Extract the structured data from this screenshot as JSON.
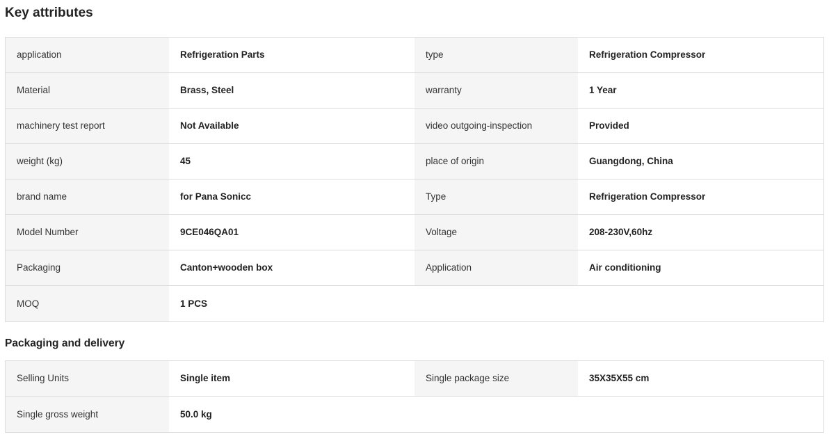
{
  "key_attributes": {
    "title": "Key attributes",
    "rows": [
      {
        "l1": "application",
        "v1": "Refrigeration Parts",
        "l2": "type",
        "v2": "Refrigeration Compressor"
      },
      {
        "l1": "Material",
        "v1": "Brass, Steel",
        "l2": "warranty",
        "v2": "1 Year"
      },
      {
        "l1": "machinery test report",
        "v1": "Not Available",
        "l2": "video outgoing-inspection",
        "v2": "Provided"
      },
      {
        "l1": "weight (kg)",
        "v1": "45",
        "l2": "place of origin",
        "v2": "Guangdong, China"
      },
      {
        "l1": "brand name",
        "v1": "for Pana Sonicc",
        "l2": "Type",
        "v2": "Refrigeration Compressor"
      },
      {
        "l1": "Model Number",
        "v1": "9CE046QA01",
        "l2": "Voltage",
        "v2": "208-230V,60hz"
      },
      {
        "l1": "Packaging",
        "v1": "Canton+wooden box",
        "l2": "Application",
        "v2": "Air conditioning"
      },
      {
        "l1": "MOQ",
        "v1": "1 PCS",
        "l2": "",
        "v2": ""
      }
    ]
  },
  "packaging_delivery": {
    "title": "Packaging and delivery",
    "rows": [
      {
        "l1": "Selling Units",
        "v1": "Single item",
        "l2": "Single package size",
        "v2": "35X35X55 cm"
      },
      {
        "l1": "Single gross weight",
        "v1": "50.0 kg",
        "l2": "",
        "v2": ""
      }
    ]
  }
}
